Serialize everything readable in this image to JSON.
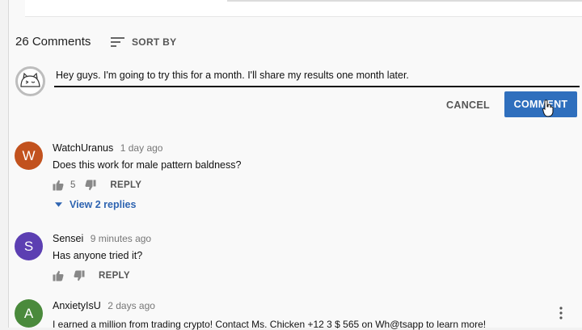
{
  "header": {
    "comments_count": "26 Comments",
    "sort_label": "SORT BY"
  },
  "new_comment": {
    "text": "Hey guys. I'm going to try this for a month. I'll share my results one month later.",
    "cancel_label": "CANCEL",
    "comment_label": "COMMENT"
  },
  "comments": [
    {
      "author": "WatchUranus",
      "time": "1 day ago",
      "avatar_letter": "W",
      "avatar_color": "#c2521e",
      "text": "Does this work for male pattern baldness?",
      "likes": "5",
      "reply_label": "REPLY",
      "view_replies": "View 2 replies"
    },
    {
      "author": "Sensei",
      "time": "9 minutes ago",
      "avatar_letter": "S",
      "avatar_color": "#5c3fb2",
      "text": "Has anyone tried it?",
      "likes": "",
      "reply_label": "REPLY"
    },
    {
      "author": "AnxietyIsU",
      "time": "2 days ago",
      "avatar_letter": "A",
      "avatar_color": "#4a8a3c",
      "text": "I earned a million from trading crypto! Contact Ms. Chicken +12 3 $ 565 on Wh@tsapp to learn more!"
    }
  ],
  "icons": {
    "sort": "sort-icon",
    "thumb_up": "thumb-up-icon",
    "thumb_down": "thumb-down-icon",
    "expand": "chevron-down-icon",
    "more": "more-vert-icon",
    "cursor": "cursor-hand-icon"
  },
  "colors": {
    "accent": "#2f6fbd",
    "link": "#2e64b1"
  }
}
